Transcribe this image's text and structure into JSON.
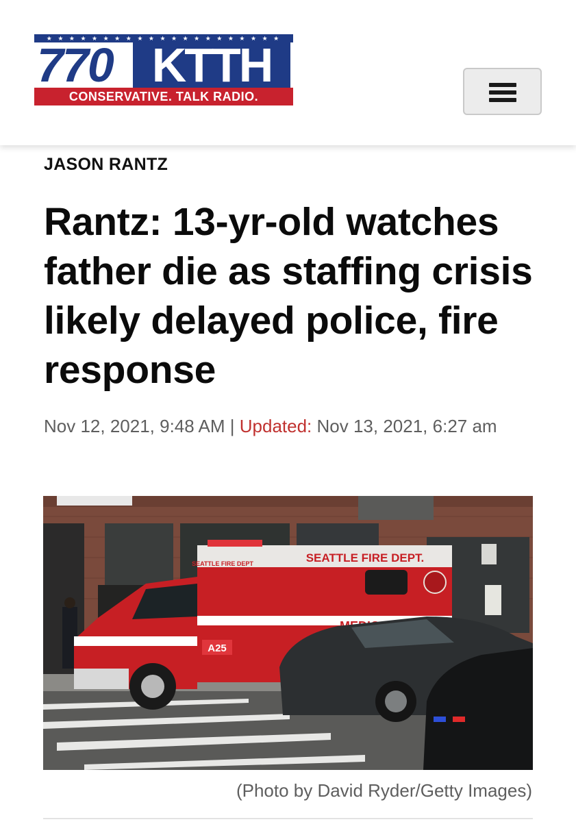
{
  "site": {
    "logo_stars": "★ ★ ★ ★ ★ ★ ★ ★ ★ ★ ★ ★ ★ ★ ★ ★ ★ ★ ★ ★ ★",
    "logo_number": "770",
    "logo_callsign": "KTTH",
    "logo_tagline": "CONSERVATIVE. TALK RADIO.",
    "brand_blue": "#1f3b86",
    "brand_red": "#c8222e"
  },
  "header": {
    "menu_icon": "hamburger-icon"
  },
  "article": {
    "category": "JASON RANTZ",
    "headline": "Rantz: 13-yr-old watches father die as staffing crisis likely delayed police, fire response",
    "published": "Nov 12, 2021, 9:48 AM",
    "separator": "|",
    "updated_label": "Updated:",
    "updated": "Nov 13, 2021, 6:27 am",
    "accent_color": "#c0312f"
  },
  "photo": {
    "ambulance_label": "SEATTLE FIRE DEPT.",
    "ambulance_small_label": "SEATTLE FIRE DEPT",
    "ambulance_unit": "A25",
    "ambulance_medic": "MEDIC",
    "caption": "(Photo by David Ryder/Getty Images)"
  }
}
